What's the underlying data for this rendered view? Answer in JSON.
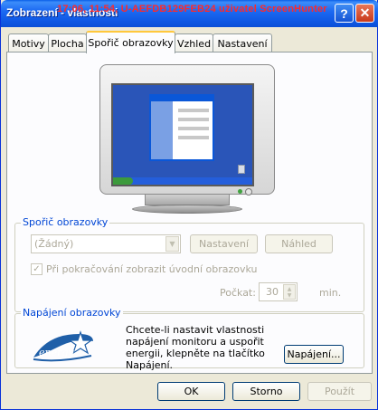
{
  "window": {
    "title": "Zobrazení - vlastnosti",
    "overlay_text": "17:06, 11:54, U-AEFDB129FEB24  uživatel  ScreenHunter",
    "help_glyph": "?",
    "close_glyph": "✕"
  },
  "tabs": [
    {
      "label": "Motivy"
    },
    {
      "label": "Plocha"
    },
    {
      "label": "Spořič obrazovky",
      "active": true
    },
    {
      "label": "Vzhled"
    },
    {
      "label": "Nastavení"
    }
  ],
  "screensaver": {
    "group_label": "Spořič obrazovky",
    "selected": "(Žádný)",
    "settings_button": "Nastavení",
    "preview_button": "Náhled",
    "resume_checkbox_label": "Při pokračování zobrazit úvodní obrazovku",
    "resume_checked": true,
    "wait_label": "Počkat:",
    "wait_value": "30",
    "wait_unit": "min."
  },
  "power": {
    "group_label": "Napájení obrazovky",
    "description": "Chcete-li nastavit vlastnosti napájení monitoru a uspořit energii, klepněte na tlačítko Napájení.",
    "button": "Napájení...",
    "logo_text": "energy"
  },
  "footer": {
    "ok": "OK",
    "cancel": "Storno",
    "apply": "Použít"
  },
  "colors": {
    "titlebar": "#0e57e3",
    "group_label": "#0046d5",
    "disabled_text": "#aca899",
    "energy_star": "#1f5fa8"
  }
}
